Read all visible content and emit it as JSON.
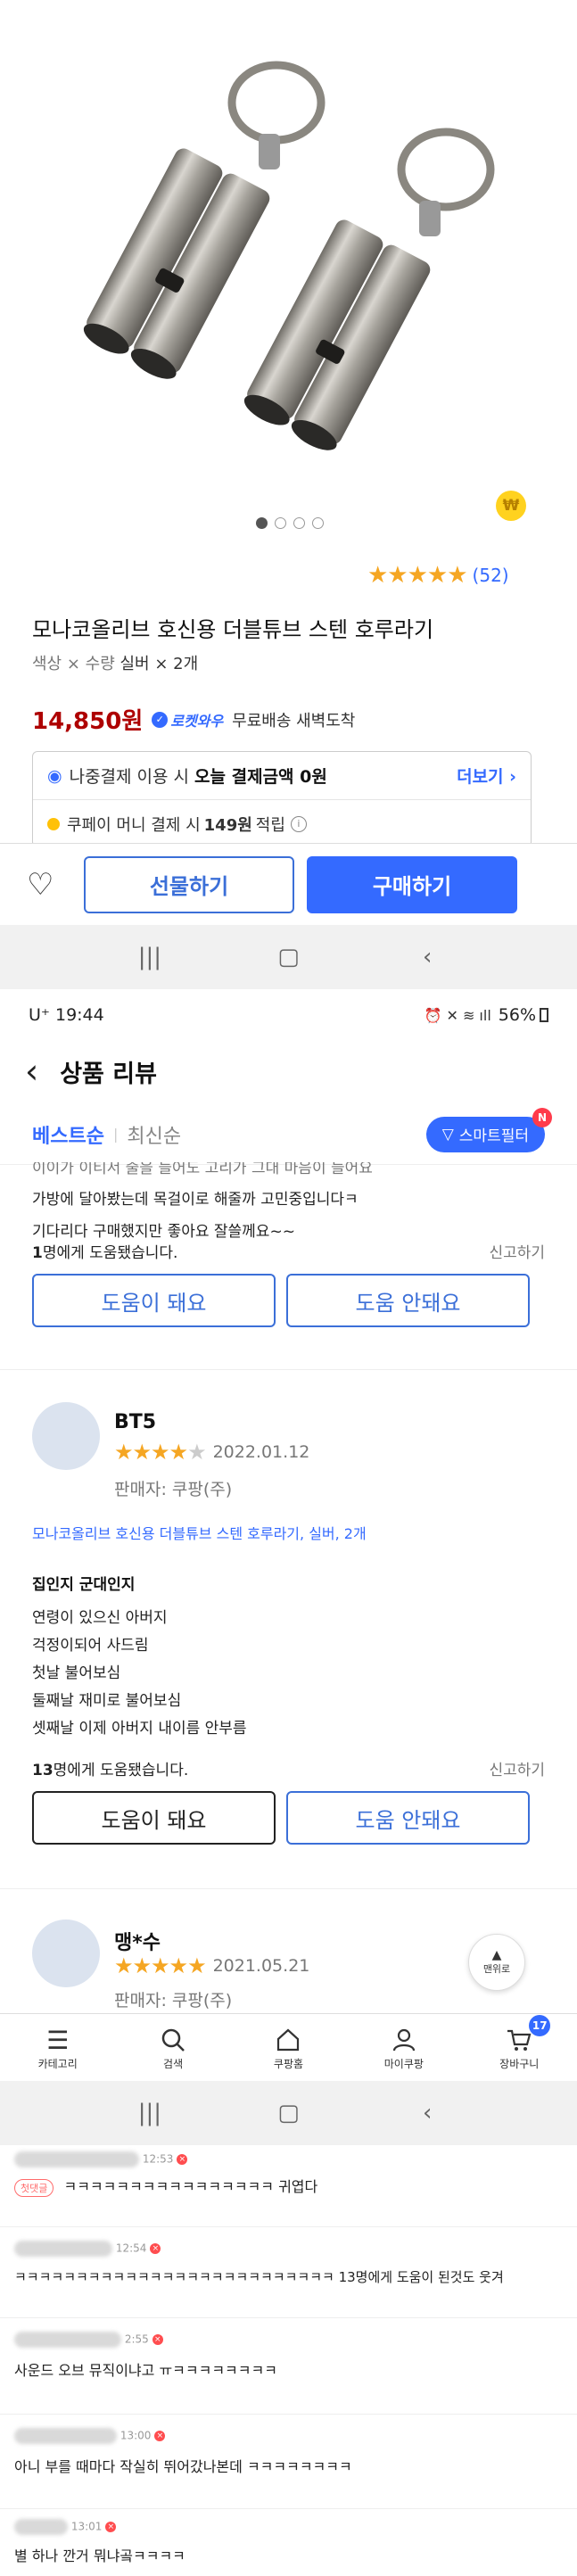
{
  "product": {
    "carousel_dots": 4,
    "rating_count": "(52)",
    "title": "모나코올리브 호신용 더블튜브 스텐 호루라기",
    "option_label": "색상 × 수량",
    "option_value": "실버 × 2개",
    "price": "14,850원",
    "rocket_label": "로켓와우",
    "delivery": "무료배송 새벽도착",
    "later_pay_prefix": "나중결제 이용 시",
    "later_pay_bold": "오늘 결제금액 0원",
    "more_link": "더보기",
    "coupay_text_a": "쿠페이 머니 결제 시",
    "coupay_text_b": "149원",
    "coupay_text_c": "적립",
    "gift_button": "선물하기",
    "buy_button": "구매하기",
    "won_badge": "₩"
  },
  "status_bar": {
    "carrier": "U⁺ 19:44",
    "right": "56%"
  },
  "review_page": {
    "title": "상품 리뷰",
    "sort_best": "베스트순",
    "sort_recent": "최신순",
    "smart_filter": "스마트필터",
    "filter_badge": "N",
    "partial_review": {
      "lines": [
        "이이가 이티서 줄을 들어도 고리가 그대 마음이 들어요",
        "가방에 달아봤는데 목걸이로 해줄까 고민중입니다ㅋ",
        "기다리다 구매했지만 좋아요 잘쓸께요~~"
      ],
      "helpful_count": "1",
      "helpful_suffix": "명에게 도움됐습니다.",
      "report": "신고하기",
      "helpful_btn": "도움이 돼요",
      "not_helpful_btn": "도움 안돼요"
    },
    "review1": {
      "author": "BT5",
      "stars": 4,
      "date": "2022.01.12",
      "seller": "판매자: 쿠팡(주)",
      "product_line": "모나코올리브 호신용 더블튜브 스텐 호루라기, 실버, 2개",
      "headline": "집인지 군대인지",
      "lines": [
        "연령이 있으신 아버지",
        "걱정이되어 사드림",
        "첫날 불어보심",
        "둘째날 재미로 불어보심",
        "셋째날 이제 아버지 내이름 안부름"
      ],
      "helpful_count": "13",
      "helpful_suffix": "명에게 도움됐습니다.",
      "report": "신고하기",
      "helpful_btn": "도움이 돼요",
      "not_helpful_btn": "도움 안돼요"
    },
    "review2": {
      "author": "맹*수",
      "stars": 5,
      "date": "2021.05.21",
      "seller": "판매자: 쿠팡(주)"
    },
    "top_button": "맨위로"
  },
  "tabbar": {
    "items": [
      {
        "label": "카테고리",
        "icon": "menu-icon"
      },
      {
        "label": "검색",
        "icon": "search-icon"
      },
      {
        "label": "쿠팡홈",
        "icon": "home-icon"
      },
      {
        "label": "마이쿠팡",
        "icon": "person-icon"
      },
      {
        "label": "장바구니",
        "icon": "cart-icon"
      }
    ],
    "cart_badge": "17"
  },
  "comments": [
    {
      "time": "12:53",
      "badge": "첫댓글",
      "text": "ㅋㅋㅋㅋㅋㅋㅋㅋㅋㅋㅋㅋㅋㅋㅋㅋ 귀엽다"
    },
    {
      "time": "12:54",
      "badge": "",
      "text": "ㅋㅋㅋㅋㅋㅋㅋㅋㅋㅋㅋㅋㅋㅋㅋㅋㅋㅋㅋㅋㅋㅋㅋㅋㅋㅋ 13명에게 도움이 된것도 웃겨"
    },
    {
      "time": "2:55",
      "badge": "",
      "text": "사운드 오브 뮤직이냐고 ㅠㅋㅋㅋㅋㅋㅋㅋㅋ"
    },
    {
      "time": "13:00",
      "badge": "",
      "text": "아니 부를 때마다 작실히 뛰어갔나본데 ㅋㅋㅋㅋㅋㅋㅋㅋ"
    },
    {
      "time": "13:01",
      "badge": "",
      "text": "별 하나 깐거 뭐냐곸ㅋㅋㅋㅋ"
    }
  ],
  "colors": {
    "accent_blue": "#346aff",
    "price_red": "#ae0000",
    "star": "#f5a623"
  }
}
